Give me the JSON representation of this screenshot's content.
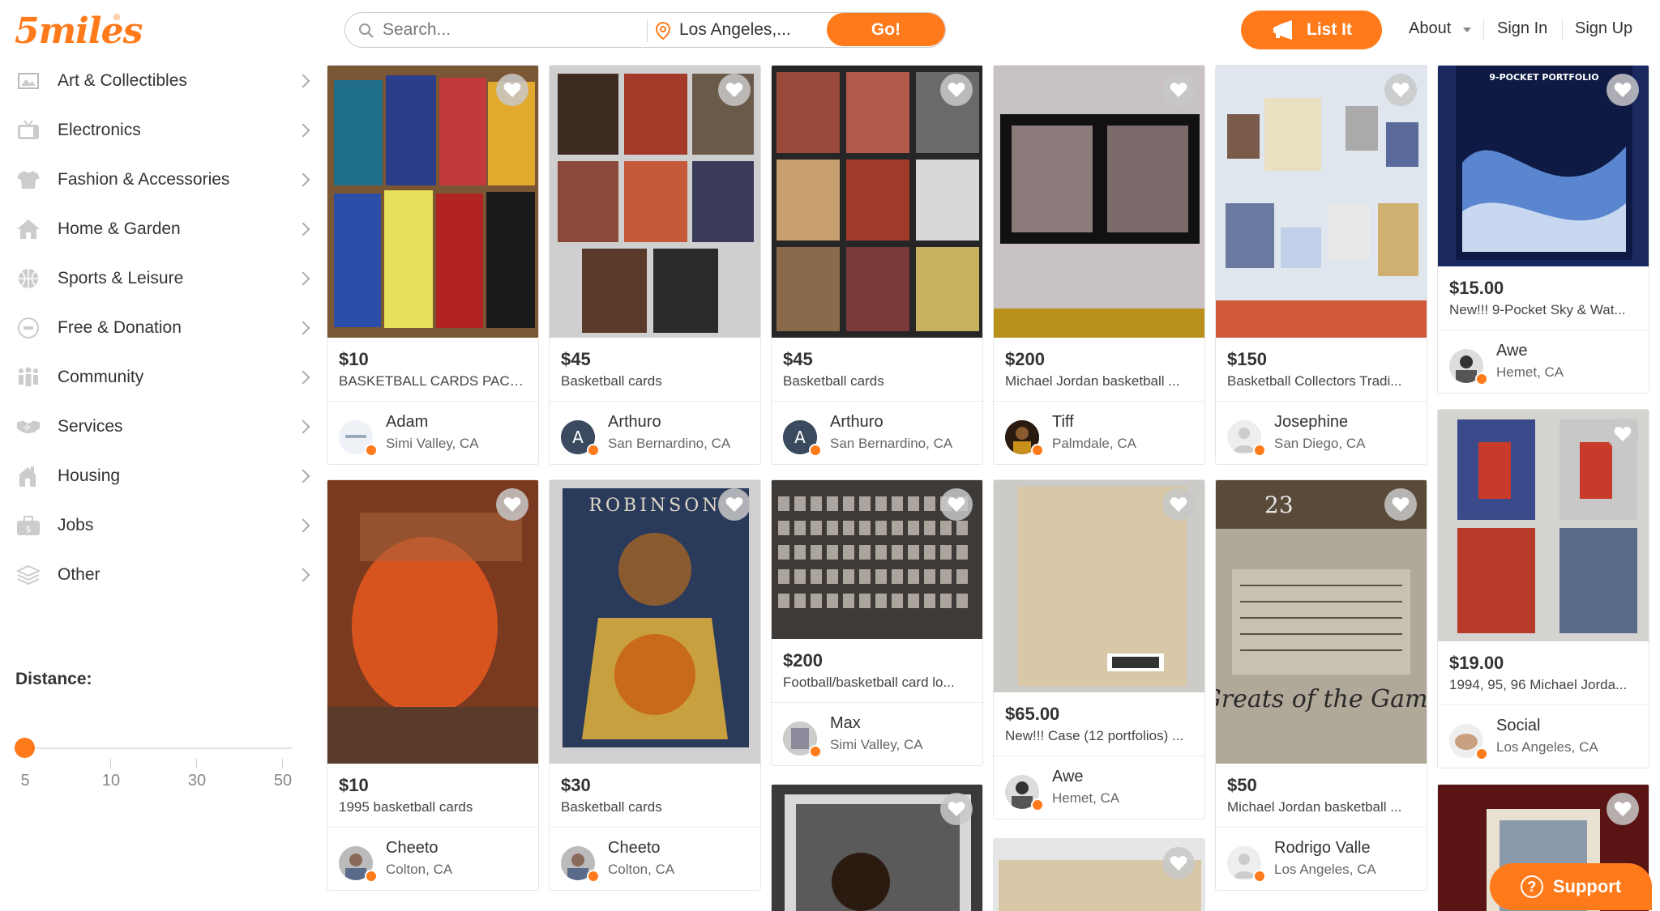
{
  "header": {
    "logo_text": "5miles",
    "logo_mark": "®",
    "search_placeholder": "Search...",
    "location_value": "Los Angeles,...",
    "go_label": "Go!",
    "list_it_label": "List It",
    "about_label": "About",
    "sign_in_label": "Sign In",
    "sign_up_label": "Sign Up"
  },
  "sidebar": {
    "categories": [
      {
        "label": "Art & Collectibles",
        "icon": "art-icon"
      },
      {
        "label": "Electronics",
        "icon": "tv-icon"
      },
      {
        "label": "Fashion & Accessories",
        "icon": "shirt-icon"
      },
      {
        "label": "Home & Garden",
        "icon": "house-icon"
      },
      {
        "label": "Sports & Leisure",
        "icon": "ball-icon"
      },
      {
        "label": "Free & Donation",
        "icon": "free-icon"
      },
      {
        "label": "Community",
        "icon": "people-icon"
      },
      {
        "label": "Services",
        "icon": "handshake-icon"
      },
      {
        "label": "Housing",
        "icon": "building-icon"
      },
      {
        "label": "Jobs",
        "icon": "briefcase-icon"
      },
      {
        "label": "Other",
        "icon": "layers-icon"
      }
    ],
    "distance_label": "Distance:",
    "distance_ticks": [
      "5",
      "10",
      "30",
      "50"
    ],
    "distance_selected": "5"
  },
  "listings": [
    {
      "price": "$10",
      "title": "BASKETBALL CARDS PACKS...",
      "seller": "Adam",
      "location": "Simi Valley, CA"
    },
    {
      "price": "$45",
      "title": "Basketball cards",
      "seller": "Arthuro",
      "location": "San Bernardino, CA"
    },
    {
      "price": "$45",
      "title": "Basketball cards",
      "seller": "Arthuro",
      "location": "San Bernardino, CA"
    },
    {
      "price": "$200",
      "title": "Michael Jordan basketball ...",
      "seller": "Tiff",
      "location": "Palmdale, CA"
    },
    {
      "price": "$150",
      "title": "Basketball Collectors Tradi...",
      "seller": "Josephine",
      "location": "San Diego, CA"
    },
    {
      "price": "$15.00",
      "title": "New!!! 9-Pocket Sky & Wat...",
      "seller": "Awe",
      "location": "Hemet, CA"
    },
    {
      "price": "$10",
      "title": "1995 basketball cards",
      "seller": "Cheeto",
      "location": "Colton, CA"
    },
    {
      "price": "$30",
      "title": "Basketball cards",
      "seller": "Cheeto",
      "location": "Colton, CA"
    },
    {
      "price": "$200",
      "title": "Football/basketball card lo...",
      "seller": "Max",
      "location": "Simi Valley, CA"
    },
    {
      "price": "$65.00",
      "title": "New!!! Case (12 portfolios) ...",
      "seller": "Awe",
      "location": "Hemet, CA"
    },
    {
      "price": "$50",
      "title": "Michael Jordan basketball ...",
      "seller": "Rodrigo Valle",
      "location": "Los Angeles, CA"
    },
    {
      "price": "$19.00",
      "title": "1994, 95, 96 Michael Jorda...",
      "seller": "Social",
      "location": "Los Angeles, CA"
    }
  ],
  "card_image_text": {
    "portfolio": "9-POCKET PORTFOLIO",
    "robinson": "ROBINSON",
    "jersey_number": "23",
    "greats": "Greats of the Game"
  },
  "support_label": "Support",
  "colors": {
    "accent": "#ff7a1a"
  }
}
